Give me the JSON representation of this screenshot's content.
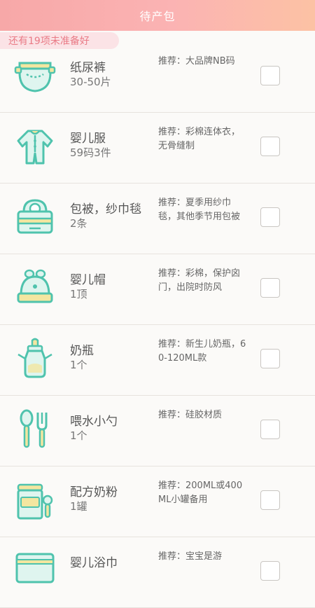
{
  "header": {
    "title": "待产包"
  },
  "banner": {
    "text": "还有19项未准备好"
  },
  "items": [
    {
      "name": "纸尿裤",
      "qty": "30-50片",
      "tip": "推荐：大品牌NB码",
      "icon": "diaper-icon"
    },
    {
      "name": "婴儿服",
      "qty": "59码3件",
      "tip": "推荐：彩棉连体衣，无骨缝制",
      "icon": "baby-clothes-icon"
    },
    {
      "name": "包被，纱巾毯",
      "qty": "2条",
      "tip": "推荐：夏季用纱巾毯，其他季节用包被",
      "icon": "swaddle-icon"
    },
    {
      "name": "婴儿帽",
      "qty": "1顶",
      "tip": "推荐：彩棉，保护囟门，出院时防风",
      "icon": "baby-hat-icon"
    },
    {
      "name": "奶瓶",
      "qty": "1个",
      "tip": "推荐：新生儿奶瓶，60-120ML款",
      "icon": "bottle-icon"
    },
    {
      "name": "喂水小勺",
      "qty": "1个",
      "tip": "推荐：硅胶材质",
      "icon": "spoon-fork-icon"
    },
    {
      "name": "配方奶粉",
      "qty": "1罐",
      "tip": "推荐：200ML或400ML小罐备用",
      "icon": "formula-can-icon"
    },
    {
      "name": "婴儿浴巾",
      "qty": "",
      "tip": "推荐：宝宝是游",
      "icon": "towel-icon"
    }
  ],
  "colors": {
    "accent": "#f7a8a8",
    "icon_teal": "#5fcfb8",
    "icon_yellow": "#f3e6a0"
  }
}
